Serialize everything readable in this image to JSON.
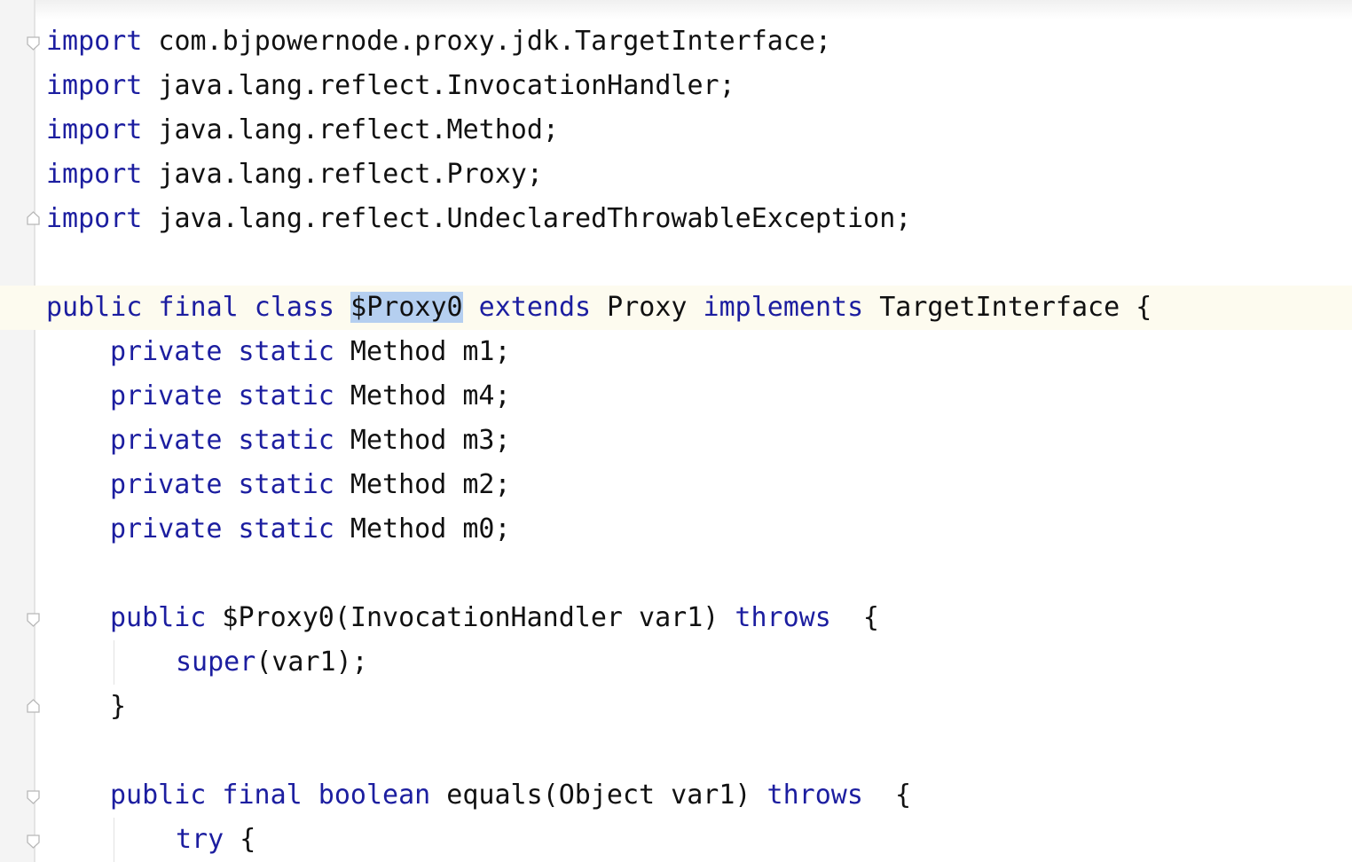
{
  "editor": {
    "colors": {
      "keyword": "#1c1ea0",
      "text": "#111111",
      "selection": "#b5cff0",
      "caret_row": "#fdfbef",
      "gutter": "#f4f4f4"
    },
    "lines": {
      "l1": {
        "k1": "import",
        "t1": " com.bjpowernode.proxy.jdk.TargetInterface;"
      },
      "l2": {
        "k1": "import",
        "t1": " java.lang.reflect.InvocationHandler;"
      },
      "l3": {
        "k1": "import",
        "t1": " java.lang.reflect.Method;"
      },
      "l4": {
        "k1": "import",
        "t1": " java.lang.reflect.Proxy;"
      },
      "l5": {
        "k1": "import",
        "t1": " java.lang.reflect.UndeclaredThrowableException;"
      },
      "l7": {
        "k1": "public final class",
        "sel": "$Proxy0",
        "k2": "extends",
        "t1": " Proxy ",
        "k3": "implements",
        "t2": " TargetInterface {"
      },
      "l8": {
        "k1": "private static",
        "t1": " Method m1;"
      },
      "l9": {
        "k1": "private static",
        "t1": " Method m4;"
      },
      "l10": {
        "k1": "private static",
        "t1": " Method m3;"
      },
      "l11": {
        "k1": "private static",
        "t1": " Method m2;"
      },
      "l12": {
        "k1": "private static",
        "t1": " Method m0;"
      },
      "l14": {
        "k1": "public",
        "t1": " $Proxy0(InvocationHandler var1) ",
        "k2": "throws",
        "t2": "  {"
      },
      "l15": {
        "k1": "super",
        "t1": "(var1);"
      },
      "l16": {
        "t1": "}"
      },
      "l18": {
        "k1": "public final boolean",
        "t1": " equals(Object var1) ",
        "k2": "throws",
        "t2": "  {"
      },
      "l19": {
        "k1": "try",
        "t1": " {"
      }
    },
    "gutter_icons": [
      "fold-open-icon",
      "fold-close-icon",
      "fold-open-icon",
      "fold-close-icon",
      "fold-open-icon",
      "fold-open-icon"
    ]
  }
}
